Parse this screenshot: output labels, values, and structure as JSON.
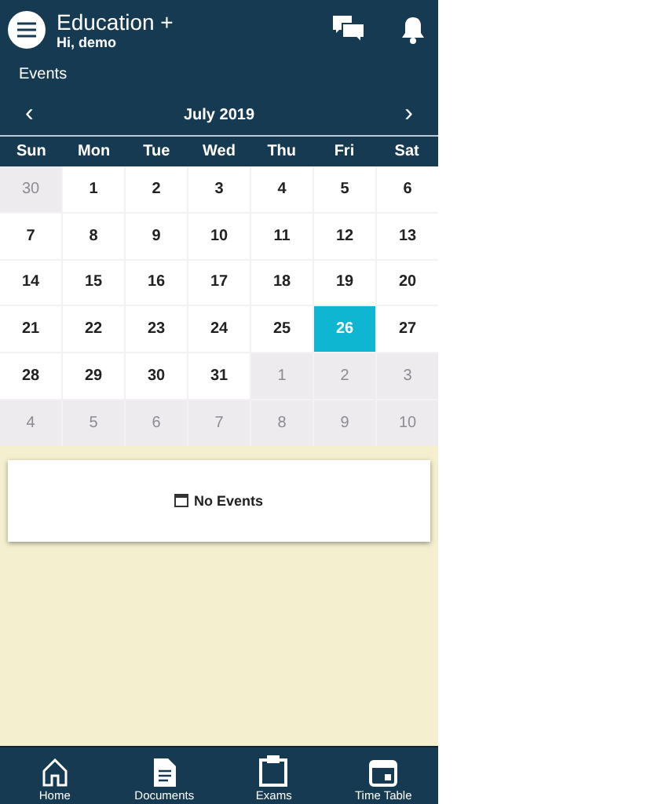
{
  "header": {
    "title": "Education +",
    "subtitle": "Hi, demo"
  },
  "section_title": "Events",
  "calendar": {
    "month": "July 2019",
    "prev": "‹",
    "next": "›",
    "weekdays": [
      "Sun",
      "Mon",
      "Tue",
      "Wed",
      "Thu",
      "Fri",
      "Sat"
    ],
    "days": [
      {
        "label": "30",
        "in_month": false,
        "selected": false
      },
      {
        "label": "1",
        "in_month": true,
        "selected": false
      },
      {
        "label": "2",
        "in_month": true,
        "selected": false
      },
      {
        "label": "3",
        "in_month": true,
        "selected": false
      },
      {
        "label": "4",
        "in_month": true,
        "selected": false
      },
      {
        "label": "5",
        "in_month": true,
        "selected": false
      },
      {
        "label": "6",
        "in_month": true,
        "selected": false
      },
      {
        "label": "7",
        "in_month": true,
        "selected": false
      },
      {
        "label": "8",
        "in_month": true,
        "selected": false
      },
      {
        "label": "9",
        "in_month": true,
        "selected": false
      },
      {
        "label": "10",
        "in_month": true,
        "selected": false
      },
      {
        "label": "11",
        "in_month": true,
        "selected": false
      },
      {
        "label": "12",
        "in_month": true,
        "selected": false
      },
      {
        "label": "13",
        "in_month": true,
        "selected": false
      },
      {
        "label": "14",
        "in_month": true,
        "selected": false
      },
      {
        "label": "15",
        "in_month": true,
        "selected": false
      },
      {
        "label": "16",
        "in_month": true,
        "selected": false
      },
      {
        "label": "17",
        "in_month": true,
        "selected": false
      },
      {
        "label": "18",
        "in_month": true,
        "selected": false
      },
      {
        "label": "19",
        "in_month": true,
        "selected": false
      },
      {
        "label": "20",
        "in_month": true,
        "selected": false
      },
      {
        "label": "21",
        "in_month": true,
        "selected": false
      },
      {
        "label": "22",
        "in_month": true,
        "selected": false
      },
      {
        "label": "23",
        "in_month": true,
        "selected": false
      },
      {
        "label": "24",
        "in_month": true,
        "selected": false
      },
      {
        "label": "25",
        "in_month": true,
        "selected": false
      },
      {
        "label": "26",
        "in_month": true,
        "selected": true
      },
      {
        "label": "27",
        "in_month": true,
        "selected": false
      },
      {
        "label": "28",
        "in_month": true,
        "selected": false
      },
      {
        "label": "29",
        "in_month": true,
        "selected": false
      },
      {
        "label": "30",
        "in_month": true,
        "selected": false
      },
      {
        "label": "31",
        "in_month": true,
        "selected": false
      },
      {
        "label": "1",
        "in_month": false,
        "selected": false
      },
      {
        "label": "2",
        "in_month": false,
        "selected": false
      },
      {
        "label": "3",
        "in_month": false,
        "selected": false
      },
      {
        "label": "4",
        "in_month": false,
        "selected": false
      },
      {
        "label": "5",
        "in_month": false,
        "selected": false
      },
      {
        "label": "6",
        "in_month": false,
        "selected": false
      },
      {
        "label": "7",
        "in_month": false,
        "selected": false
      },
      {
        "label": "8",
        "in_month": false,
        "selected": false
      },
      {
        "label": "9",
        "in_month": false,
        "selected": false
      },
      {
        "label": "10",
        "in_month": false,
        "selected": false
      }
    ]
  },
  "events_message": "No Events",
  "bottom_nav": [
    {
      "label": "Home",
      "kind": "home"
    },
    {
      "label": "Documents",
      "kind": "document"
    },
    {
      "label": "Exams",
      "kind": "clipboard"
    },
    {
      "label": "Time Table",
      "kind": "calendar"
    }
  ]
}
